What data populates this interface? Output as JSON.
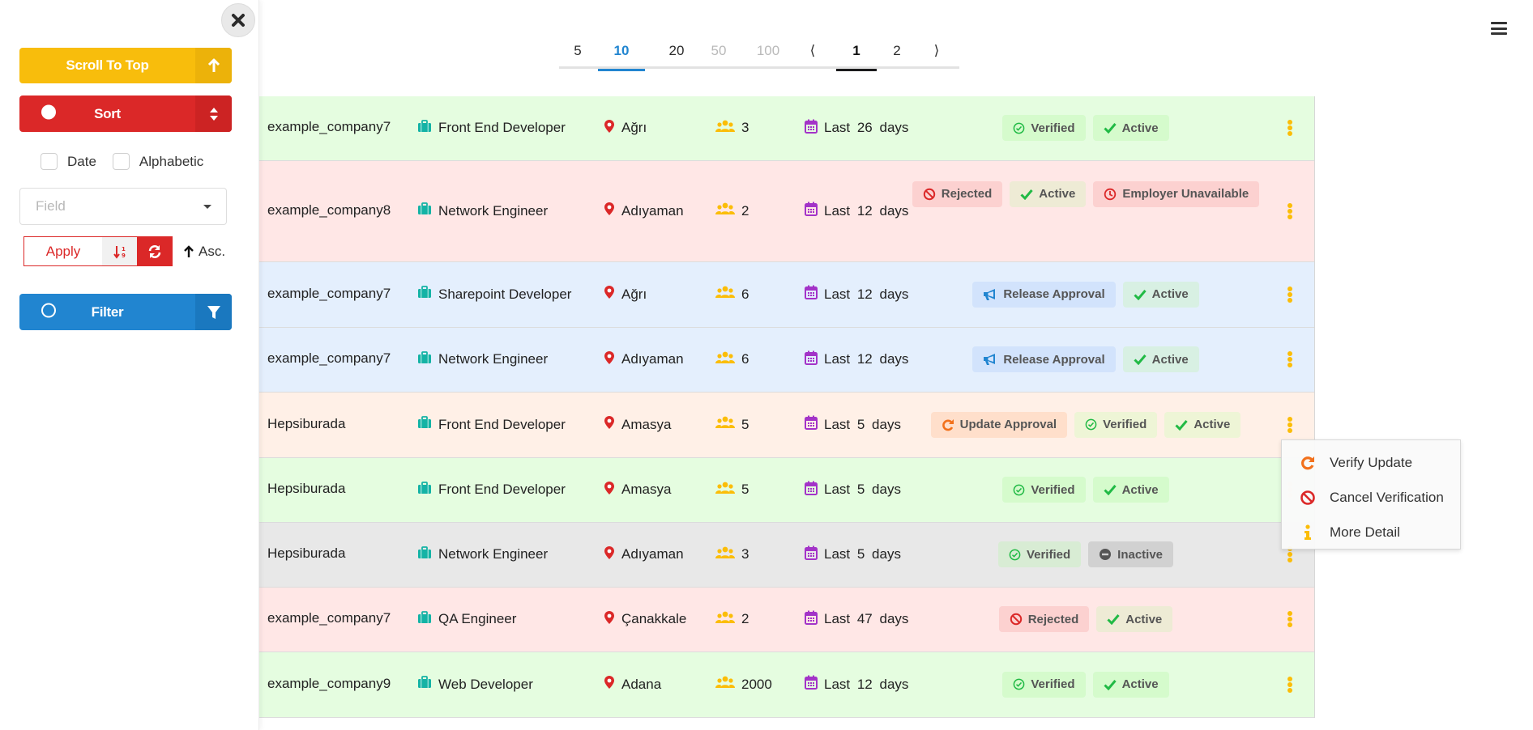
{
  "sidebar": {
    "scroll_top_label": "Scroll To Top",
    "sort_label": "Sort",
    "filter_label": "Filter",
    "checkboxes": [
      {
        "label": "Date",
        "checked": false
      },
      {
        "label": "Alphabetic",
        "checked": false
      }
    ],
    "field_placeholder": "Field",
    "apply_label": "Apply",
    "order_label": "Asc."
  },
  "pagination": {
    "page_sizes": [
      {
        "label": "5",
        "state": "normal"
      },
      {
        "label": "10",
        "state": "active"
      },
      {
        "label": "20",
        "state": "normal"
      },
      {
        "label": "50",
        "state": "disabled"
      },
      {
        "label": "100",
        "state": "disabled"
      }
    ],
    "prev_label": "⟨",
    "pages": [
      {
        "label": "1",
        "state": "active"
      },
      {
        "label": "2",
        "state": "normal"
      }
    ],
    "next_label": "⟩"
  },
  "colors": {
    "yellow": "#f8bd0c",
    "red": "#db2828",
    "blue": "#2185d0",
    "teal": "#14b3a5",
    "purple": "#a333c8",
    "green": "#21ba45",
    "orange": "#f2711c"
  },
  "rows": [
    {
      "tone": "green",
      "company": "example_company7",
      "job": "Front End Developer",
      "location": "Ağrı",
      "people": "3",
      "date": "Last 26 days",
      "badges": [
        {
          "type": "verified",
          "label": "Verified"
        },
        {
          "type": "active",
          "label": "Active"
        }
      ]
    },
    {
      "tone": "red",
      "company": "example_company8",
      "job": "Network Engineer",
      "location": "Adıyaman",
      "people": "2",
      "date": "Last 12 days",
      "badges": [
        {
          "type": "rejected",
          "label": "Rejected"
        },
        {
          "type": "active-red",
          "label": "Active"
        },
        {
          "type": "unavailable",
          "label": "Employer Unavailable"
        }
      ]
    },
    {
      "tone": "blue",
      "company": "example_company7",
      "job": "Sharepoint Developer",
      "location": "Ağrı",
      "people": "6",
      "date": "Last 12 days",
      "badges": [
        {
          "type": "release",
          "label": "Release Approval"
        },
        {
          "type": "active-blue",
          "label": "Active"
        }
      ]
    },
    {
      "tone": "blue",
      "company": "example_company7",
      "job": "Network Engineer",
      "location": "Adıyaman",
      "people": "6",
      "date": "Last 12 days",
      "badges": [
        {
          "type": "release",
          "label": "Release Approval"
        },
        {
          "type": "active-blue",
          "label": "Active"
        }
      ]
    },
    {
      "tone": "orange",
      "company": "Hepsiburada",
      "job": "Front End Developer",
      "location": "Amasya",
      "people": "5",
      "date": "Last 5 days",
      "badges": [
        {
          "type": "update",
          "label": "Update Approval"
        },
        {
          "type": "verified-orange",
          "label": "Verified"
        },
        {
          "type": "active-orange",
          "label": "Active"
        }
      ]
    },
    {
      "tone": "green",
      "company": "Hepsiburada",
      "job": "Front End Developer",
      "location": "Amasya",
      "people": "5",
      "date": "Last 5 days",
      "badges": [
        {
          "type": "verified",
          "label": "Verified"
        },
        {
          "type": "active",
          "label": "Active"
        }
      ]
    },
    {
      "tone": "grey",
      "company": "Hepsiburada",
      "job": "Network Engineer",
      "location": "Adıyaman",
      "people": "3",
      "date": "Last 5 days",
      "badges": [
        {
          "type": "verified-grey",
          "label": "Verified"
        },
        {
          "type": "inactive",
          "label": "Inactive"
        }
      ]
    },
    {
      "tone": "red",
      "company": "example_company7",
      "job": "QA Engineer",
      "location": "Çanakkale",
      "people": "2",
      "date": "Last 47 days",
      "badges": [
        {
          "type": "rejected",
          "label": "Rejected"
        },
        {
          "type": "active-red",
          "label": "Active"
        }
      ]
    },
    {
      "tone": "green",
      "company": "example_company9",
      "job": "Web Developer",
      "location": "Adana",
      "people": "2000",
      "date": "Last 12 days",
      "badges": [
        {
          "type": "verified",
          "label": "Verified"
        },
        {
          "type": "active",
          "label": "Active"
        }
      ]
    }
  ],
  "context_menu": {
    "items": [
      {
        "label": "Verify Update",
        "icon": "redo-icon"
      },
      {
        "label": "Cancel Verification",
        "icon": "ban-icon"
      },
      {
        "label": "More Detail",
        "icon": "info-icon"
      }
    ]
  }
}
